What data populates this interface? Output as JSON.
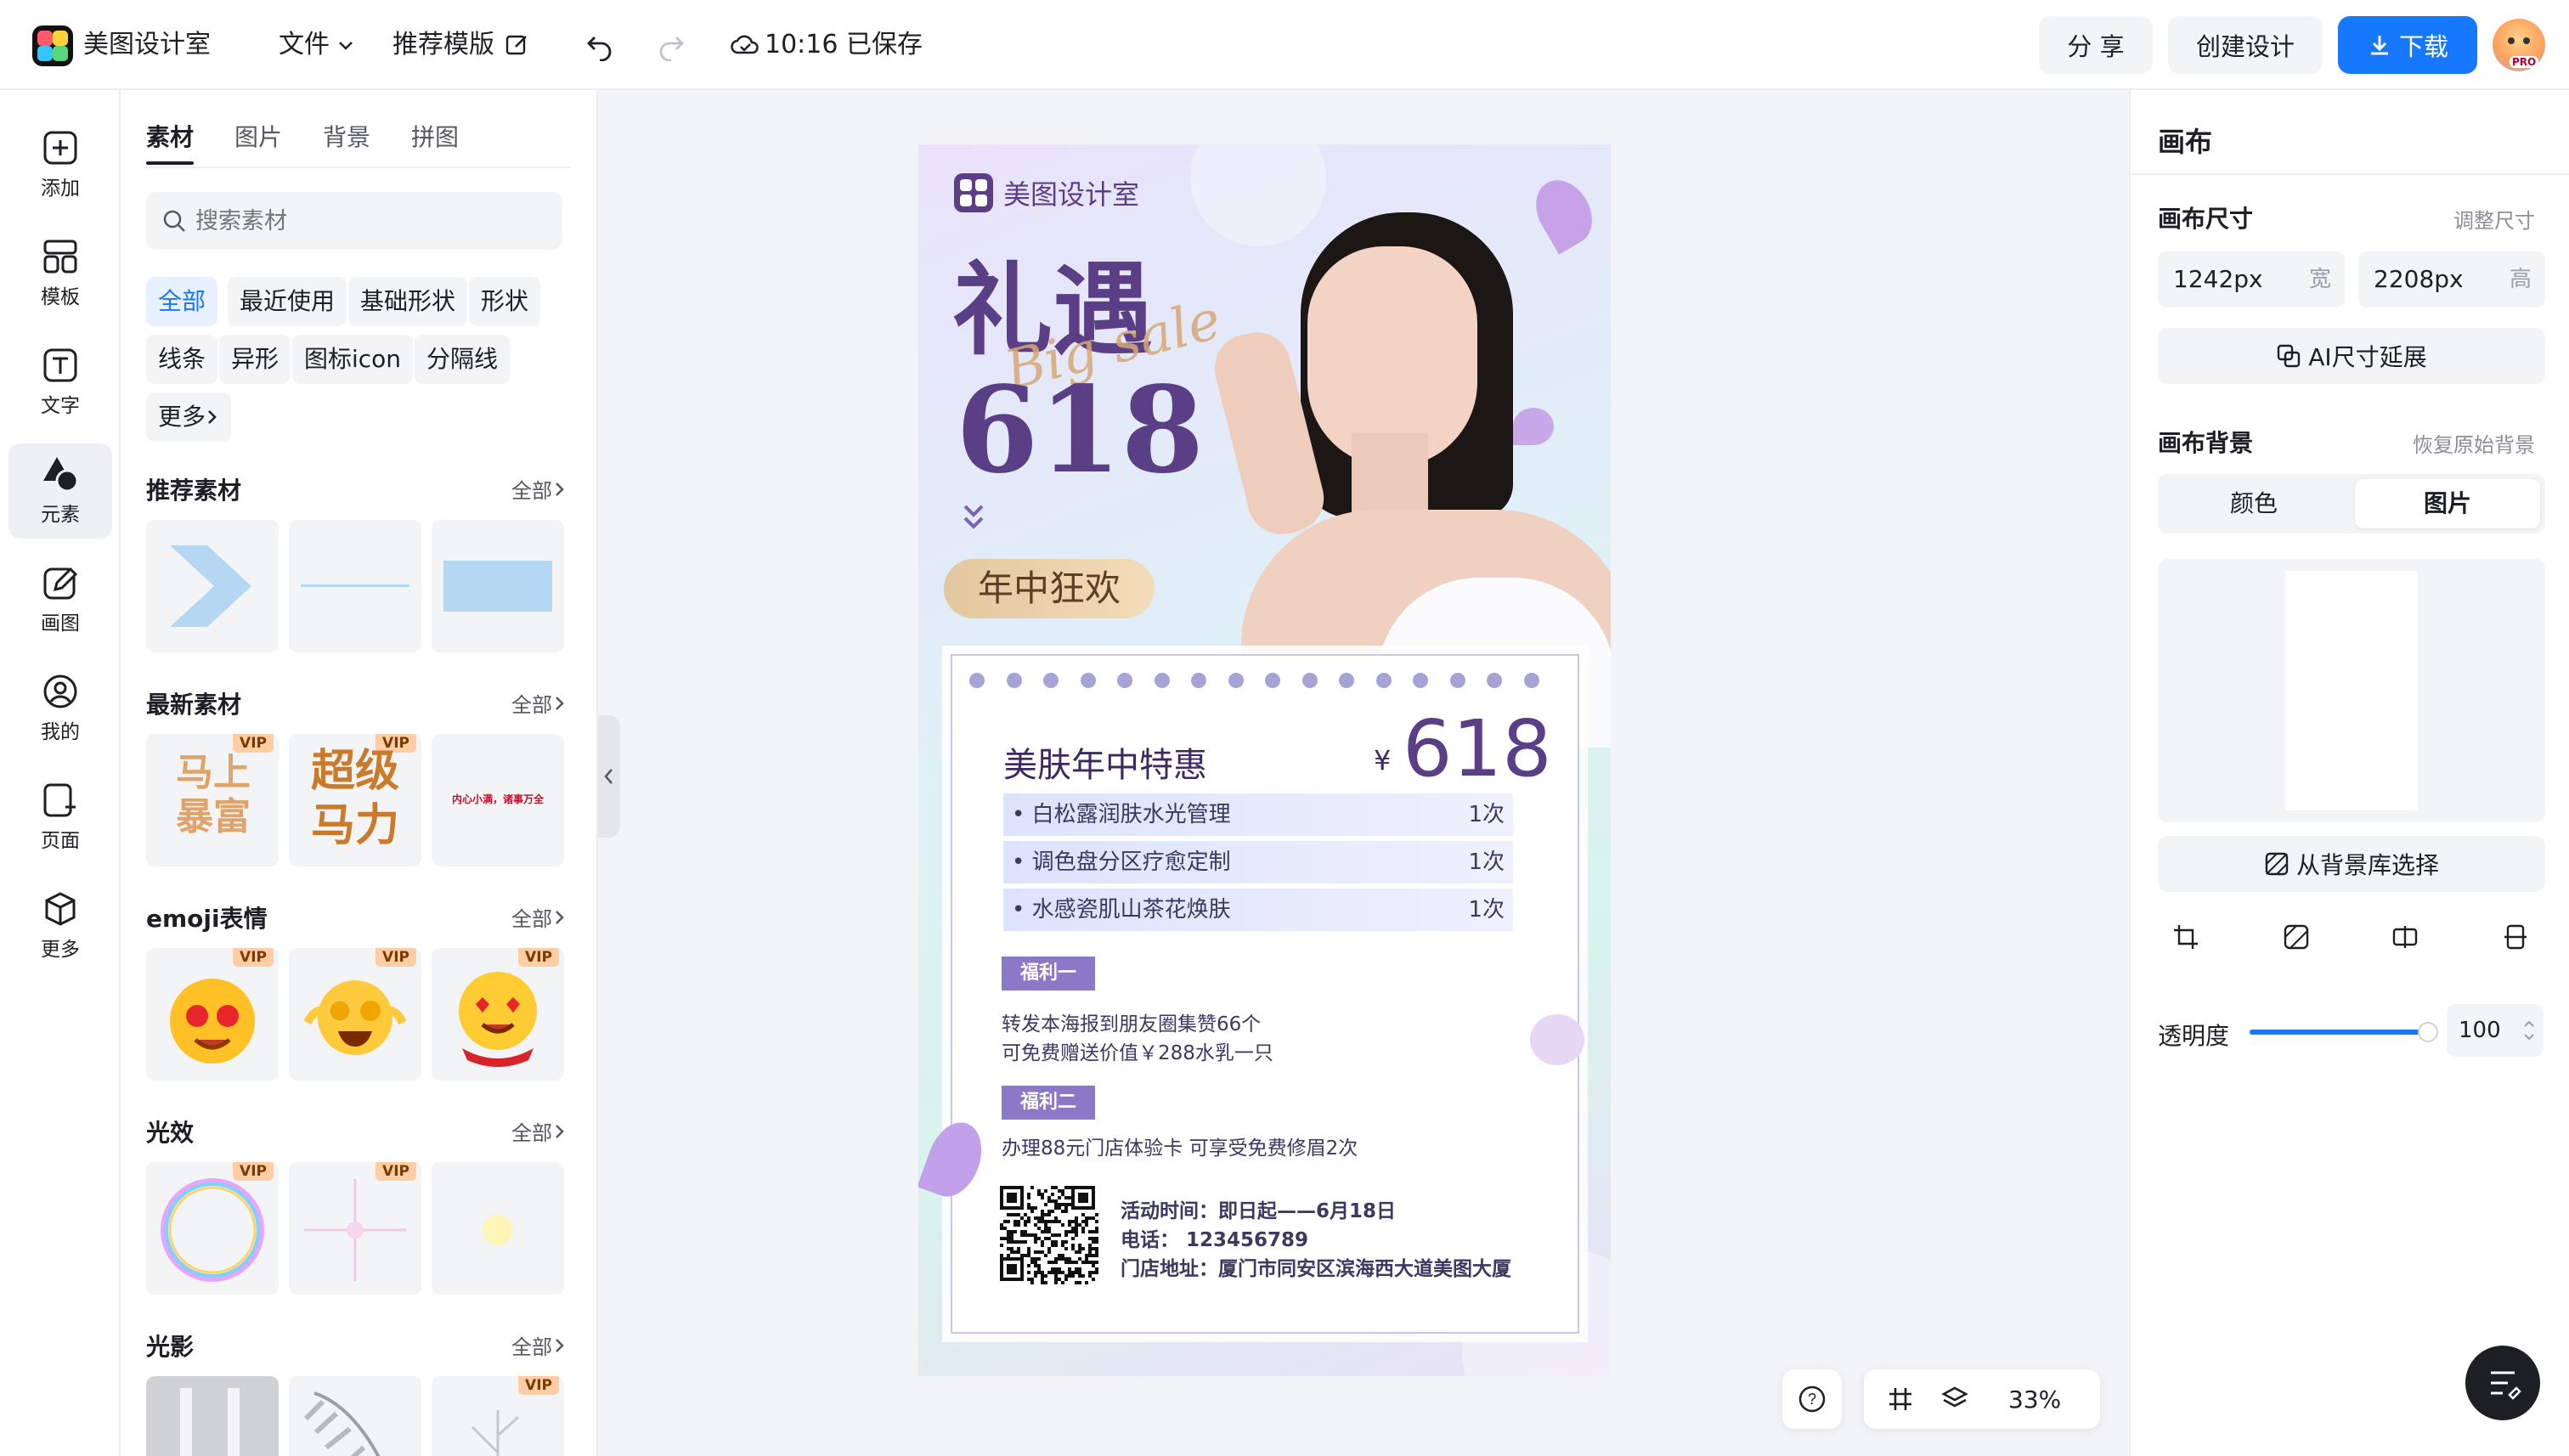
{
  "topbar": {
    "app_name": "美图设计室",
    "file_menu": "文件",
    "template_name": "推荐模版",
    "save_status": "10:16 已保存",
    "share_label": "分 享",
    "create_label": "创建设计",
    "download_label": "下载",
    "pro_badge": "PRO"
  },
  "rail": {
    "items": [
      {
        "label": "添加",
        "icon": "plus-square-icon"
      },
      {
        "label": "模板",
        "icon": "template-icon"
      },
      {
        "label": "文字",
        "icon": "text-icon"
      },
      {
        "label": "元素",
        "icon": "shapes-icon"
      },
      {
        "label": "画图",
        "icon": "pencil-icon"
      },
      {
        "label": "我的",
        "icon": "user-icon"
      },
      {
        "label": "页面",
        "icon": "page-add-icon"
      },
      {
        "label": "更多",
        "icon": "cube-icon"
      }
    ]
  },
  "panel": {
    "tabs": [
      "素材",
      "图片",
      "背景",
      "拼图"
    ],
    "search_placeholder": "搜索素材",
    "chips": [
      "全部",
      "最近使用",
      "基础形状",
      "形状",
      "线条",
      "异形",
      "图标icon",
      "分隔线",
      "更多"
    ],
    "all_label": "全部",
    "vip_label": "VIP",
    "sections": {
      "recommended": "推荐素材",
      "latest": "最新素材",
      "emoji": "emoji表情",
      "light": "光效",
      "shadow": "光影"
    },
    "latest_tiles": [
      "马上\n暴富",
      "超级\n马力",
      "内心小满，诸事万全"
    ]
  },
  "poster": {
    "brand": "美图设计室",
    "headline": "礼遇",
    "script_text": "Big sale",
    "big_number": "618",
    "subtitle": "年中狂欢",
    "card_title": "美肤年中特惠",
    "price_symbol": "¥",
    "price": "618",
    "items": [
      {
        "name": "白松露润肤水光管理",
        "qty": "1次"
      },
      {
        "name": "调色盘分区疗愈定制",
        "qty": "1次"
      },
      {
        "name": "水感瓷肌山茶花焕肤",
        "qty": "1次"
      }
    ],
    "benefit1_label": "福利一",
    "benefit1_line1": "转发本海报到朋友圈集赞66个",
    "benefit1_line2": "可免费赠送价值￥288水乳一只",
    "benefit2_label": "福利二",
    "benefit2_line": "办理88元门店体验卡 可享受免费修眉2次",
    "info_time": "活动时间：即日起——6月18日",
    "info_phone": "电话： 123456789",
    "info_address": "门店地址：厦门市同安区滨海西大道美图大厦"
  },
  "right_panel": {
    "title": "画布",
    "size_label": "画布尺寸",
    "resize_label": "调整尺寸",
    "width_value": "1242px",
    "width_unit": "宽",
    "height_value": "2208px",
    "height_unit": "高",
    "ai_extend_label": "AI尺寸延展",
    "bg_label": "画布背景",
    "restore_label": "恢复原始背景",
    "seg_color": "颜色",
    "seg_image": "图片",
    "bg_library_label": "从背景库选择",
    "opacity_label": "透明度",
    "opacity_value": "100",
    "opacity_fraction": 1.0
  },
  "bottom": {
    "zoom": "33%",
    "help": "?"
  },
  "colors": {
    "accent": "#1677ff",
    "poster_purple": "#5a3f86",
    "badge_purple": "#8a79c7"
  }
}
